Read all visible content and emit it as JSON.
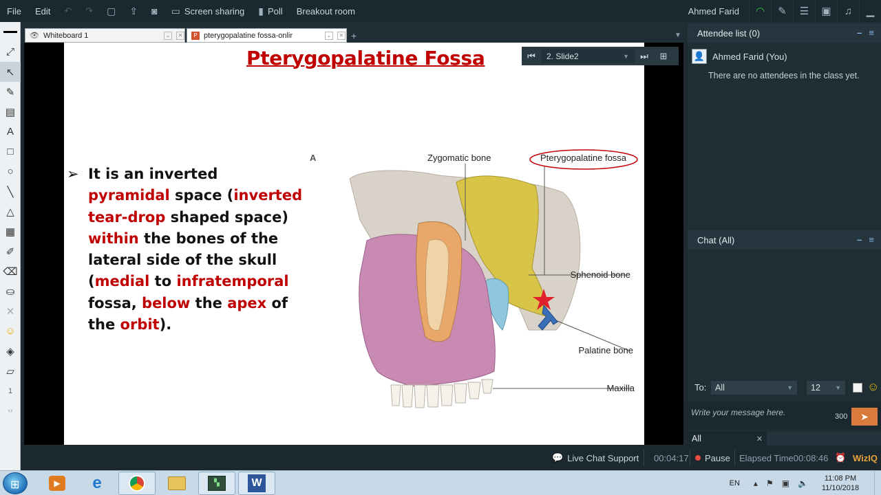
{
  "menubar": {
    "file": "File",
    "edit": "Edit",
    "screen_sharing": "Screen sharing",
    "poll": "Poll",
    "breakout_room": "Breakout room",
    "user_name": "Ahmed Farid"
  },
  "tabs": [
    {
      "label": "Whiteboard 1",
      "icon": "eye-icon"
    },
    {
      "label": "pterygopalatine fossa-onlir",
      "icon": "powerpoint-icon"
    }
  ],
  "slide_nav": {
    "current": "2. Slide2"
  },
  "slide": {
    "title": "Pterygopalatine Fossa",
    "bullet_parts": [
      {
        "text": "It is an inverted ",
        "red": false
      },
      {
        "text": "pyramidal",
        "red": true
      },
      {
        "text": " space (",
        "red": false
      },
      {
        "text": "inverted tear-drop",
        "red": true
      },
      {
        "text": " shaped space) ",
        "red": false
      },
      {
        "text": "within",
        "red": true
      },
      {
        "text": " the bones of the lateral side of the skull (",
        "red": false
      },
      {
        "text": "medial",
        "red": true
      },
      {
        "text": " to ",
        "red": false
      },
      {
        "text": "infratemporal",
        "red": true
      },
      {
        "text": " fossa, ",
        "red": false
      },
      {
        "text": "below",
        "red": true
      },
      {
        "text": " the ",
        "red": false
      },
      {
        "text": "apex",
        "red": true
      },
      {
        "text": " of the ",
        "red": false
      },
      {
        "text": "orbit",
        "red": true
      },
      {
        "text": ").",
        "red": false
      }
    ],
    "figure": {
      "panel_letter": "A",
      "labels": {
        "zygomatic": "Zygomatic bone",
        "pterygopalatine": "Pterygopalatine fossa",
        "sphenoid": "Sphenoid bone",
        "palatine": "Palatine bone",
        "maxilla": "Maxilla"
      }
    }
  },
  "attendees": {
    "title": "Attendee list (0)",
    "me": "Ahmed Farid (You)",
    "empty_message": "There are no attendees in the class yet."
  },
  "chat": {
    "title": "Chat (All)",
    "to_label": "To:",
    "to_value": "All",
    "font_size": "12",
    "placeholder": "Write your message here.",
    "char_count": "300",
    "tab_label": "All"
  },
  "status": {
    "live_chat": "Live Chat Support",
    "session_time": "00:04:17",
    "pause": "Pause",
    "elapsed_label": "Elapsed Time",
    "elapsed_value": "00:08:46",
    "brand": "WizIQ"
  },
  "taskbar": {
    "lang": "EN",
    "time": "11:08 PM",
    "date": "11/10/2018"
  },
  "colors": {
    "accent_red": "#c00000",
    "panel_bg": "#1f2d35",
    "send_button": "#d97b3a"
  }
}
